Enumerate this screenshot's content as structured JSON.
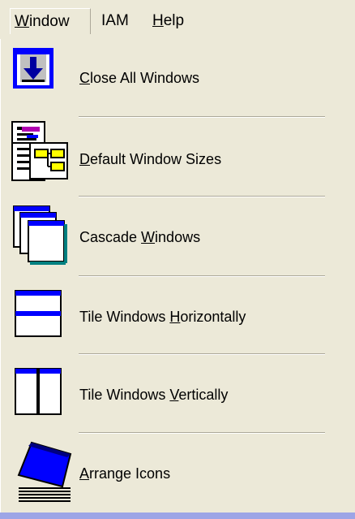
{
  "menubar": {
    "items": [
      {
        "label": "Window",
        "mnemonic_index": 0
      },
      {
        "label": "IAM",
        "mnemonic_index": -1
      },
      {
        "label": "Help",
        "mnemonic_index": 0
      }
    ]
  },
  "window_menu": {
    "items": [
      {
        "label": "Close All Windows",
        "mnemonic": "C",
        "icon": "close-all-windows-icon"
      },
      {
        "label": "Default Window Sizes",
        "mnemonic": "D",
        "icon": "default-window-sizes-icon"
      },
      {
        "label": "Cascade Windows",
        "mnemonic": "W",
        "icon": "cascade-windows-icon"
      },
      {
        "label": "Tile Windows Horizontally",
        "mnemonic": "H",
        "icon": "tile-horizontal-icon"
      },
      {
        "label": "Tile Windows Vertically",
        "mnemonic": "V",
        "icon": "tile-vertical-icon"
      },
      {
        "label": "Arrange Icons",
        "mnemonic": "A",
        "icon": "arrange-icons-icon"
      }
    ]
  },
  "colors": {
    "menu_background": "#ece9d8",
    "icon_blue": "#0000ff",
    "bottom_bar": "#9da5e6"
  }
}
